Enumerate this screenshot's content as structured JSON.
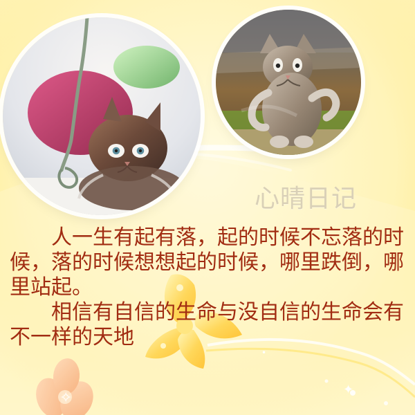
{
  "icons": {
    "left_photo": "kitten-with-string-photo",
    "right_photo": "standing-kitten-photo",
    "decor_flower": "flower-icon",
    "decor_sparkle": "sparkle-icon"
  },
  "heading": {
    "title": "心晴日记"
  },
  "content": {
    "paragraphs": [
      "人一生有起有落，起的时候不忘落的时候，落的时候想想起的时候，哪里跌倒，哪里站起。",
      "相信有自信的生命与没自信的生命会有不一样的天地"
    ]
  }
}
